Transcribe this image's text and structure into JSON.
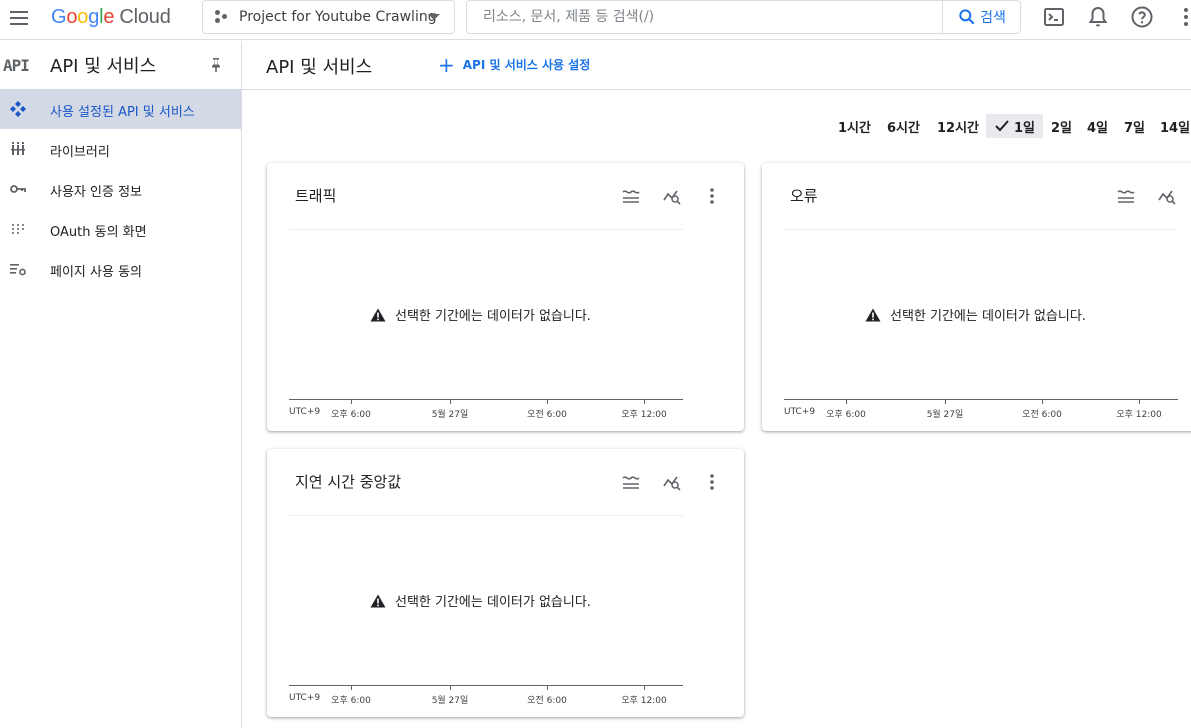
{
  "topbar": {
    "logo_google": "Google",
    "logo_cloud": "Cloud",
    "project_name": "Project for Youtube Crawling",
    "search_placeholder": "리소스, 문서, 제품 등 검색(/)",
    "search_button": "검색"
  },
  "sidebar": {
    "api_icon_text": "API",
    "title": "API 및 서비스",
    "items": [
      {
        "label": "사용 설정된 API 및 서비스",
        "icon": "api-diamond-icon",
        "active": true
      },
      {
        "label": "라이브러리",
        "icon": "library-icon",
        "active": false
      },
      {
        "label": "사용자 인증 정보",
        "icon": "key-icon",
        "active": false
      },
      {
        "label": "OAuth 동의 화면",
        "icon": "oauth-grid-icon",
        "active": false
      },
      {
        "label": "페이지 사용 동의",
        "icon": "page-settings-icon",
        "active": false
      }
    ]
  },
  "main": {
    "title": "API 및 서비스",
    "enable_button": "API 및 서비스 사용 설정"
  },
  "ranges": [
    {
      "label": "1시간",
      "active": false
    },
    {
      "label": "6시간",
      "active": false
    },
    {
      "label": "12시간",
      "active": false
    },
    {
      "label": "1일",
      "active": true
    },
    {
      "label": "2일",
      "active": false
    },
    {
      "label": "4일",
      "active": false
    },
    {
      "label": "7일",
      "active": false
    },
    {
      "label": "14일",
      "active": false
    }
  ],
  "cards": [
    {
      "title": "트래픽"
    },
    {
      "title": "오류"
    },
    {
      "title": "지연 시간 중앙값"
    }
  ],
  "chart_common": {
    "no_data": "선택한 기간에는 데이터가 없습니다.",
    "timezone": "UTC+9",
    "ticks": [
      "오후 6:00",
      "5월 27일",
      "오전 6:00",
      "오후 12:00"
    ]
  },
  "colors": {
    "accent": "#1a73e8",
    "active_nav_bg": "#d3d9e5",
    "active_nav_text": "#1a56c9"
  }
}
